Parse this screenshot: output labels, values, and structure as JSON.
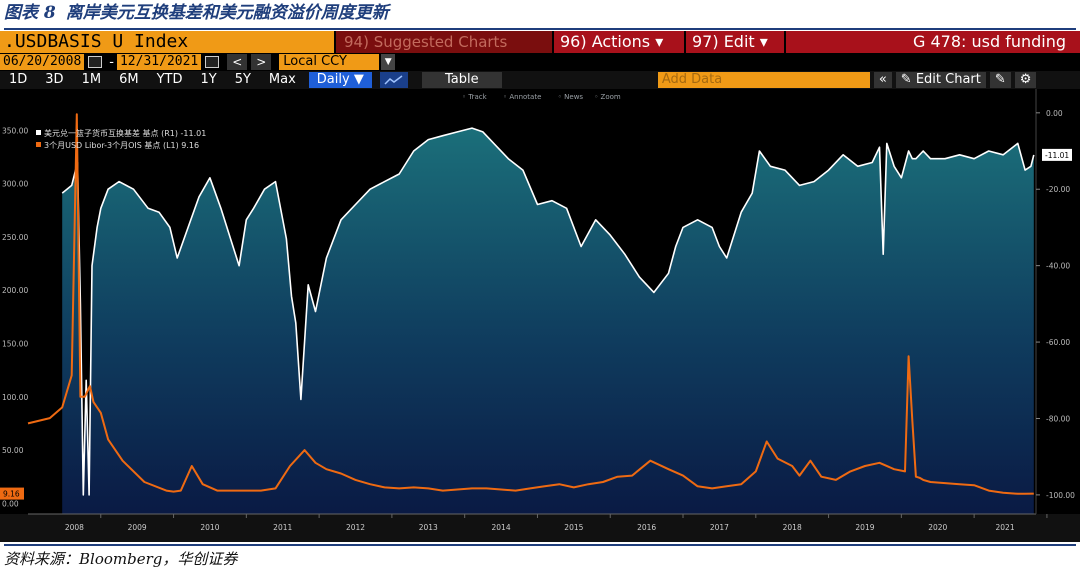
{
  "figure": {
    "label": "图表 8",
    "title": "离岸美元互换基差和美元融资溢价周度更新",
    "source": "资料来源：Bloomberg，华创证券"
  },
  "toolbar": {
    "ticker": ".USDBASIS U Index",
    "suggested": "94) Suggested Charts",
    "actions": "96) Actions ▾",
    "edit": "97) Edit ▾",
    "function": "G 478: usd funding"
  },
  "dates": {
    "start": "06/20/2008",
    "end": "12/31/2021",
    "currency": "Local CCY",
    "prev": "<",
    "next": ">"
  },
  "ranges": [
    "1D",
    "3D",
    "1M",
    "6M",
    "YTD",
    "1Y",
    "5Y",
    "Max"
  ],
  "controls": {
    "frequency": "Daily ▼",
    "table": "Table",
    "add_data_placeholder": "Add Data",
    "collapse": "«",
    "edit_chart": "✎ Edit Chart",
    "undo": "↶",
    "redo": "↷"
  },
  "chart_tools": [
    "Track",
    "Annotate",
    "News",
    "Zoom"
  ],
  "chart_data": {
    "type": "line",
    "x_labels": [
      "2008",
      "2009",
      "2010",
      "2011",
      "2012",
      "2013",
      "2014",
      "2015",
      "2016",
      "2017",
      "2018",
      "2019",
      "2020",
      "2021"
    ],
    "left_axis": {
      "ticks": [
        "350.00",
        "300.00",
        "250.00",
        "200.00",
        "150.00",
        "100.00",
        "50.00",
        "0.00"
      ],
      "range": [
        -10,
        370
      ]
    },
    "right_axis": {
      "ticks": [
        "0.00",
        "-20.00",
        "-40.00",
        "-60.00",
        "-80.00",
        "-100.00"
      ],
      "range": [
        -105,
        1
      ]
    },
    "series": [
      {
        "name": "美元兑一篮子货币互换基差 基点 (R1) -11.01",
        "axis": "right",
        "color": "#ffffff",
        "last_label": "-11.01",
        "x": [
          2008.47,
          2008.6,
          2008.68,
          2008.72,
          2008.76,
          2008.8,
          2008.84,
          2008.88,
          2008.95,
          2009.0,
          2009.1,
          2009.25,
          2009.45,
          2009.65,
          2009.8,
          2009.95,
          2010.05,
          2010.2,
          2010.35,
          2010.5,
          2010.65,
          2010.8,
          2010.9,
          2011.0,
          2011.1,
          2011.25,
          2011.4,
          2011.55,
          2011.62,
          2011.68,
          2011.75,
          2011.85,
          2011.95,
          2012.1,
          2012.3,
          2012.5,
          2012.7,
          2012.9,
          2013.1,
          2013.3,
          2013.5,
          2013.7,
          2013.9,
          2014.1,
          2014.25,
          2014.4,
          2014.6,
          2014.8,
          2015.0,
          2015.2,
          2015.4,
          2015.6,
          2015.8,
          2016.0,
          2016.2,
          2016.4,
          2016.6,
          2016.8,
          2016.9,
          2017.0,
          2017.2,
          2017.4,
          2017.5,
          2017.6,
          2017.8,
          2017.95,
          2018.05,
          2018.2,
          2018.4,
          2018.6,
          2018.8,
          2019.0,
          2019.2,
          2019.4,
          2019.6,
          2019.7,
          2019.75,
          2019.8,
          2019.9,
          2020.0,
          2020.1,
          2020.15,
          2020.2,
          2020.3,
          2020.4,
          2020.6,
          2020.8,
          2021.0,
          2021.2,
          2021.4,
          2021.6,
          2021.7,
          2021.78,
          2021.82
        ],
        "y": [
          -21,
          -19,
          -13,
          -50,
          -100,
          -70,
          -100,
          -40,
          -30,
          -25,
          -20,
          -18,
          -20,
          -25,
          -26,
          -30,
          -38,
          -30,
          -22,
          -17,
          -25,
          -34,
          -40,
          -28,
          -25,
          -20,
          -18,
          -33,
          -48,
          -55,
          -75,
          -45,
          -52,
          -38,
          -28,
          -24,
          -20,
          -18,
          -16,
          -10,
          -7,
          -6,
          -5,
          -4,
          -5,
          -8,
          -12,
          -15,
          -24,
          -23,
          -25,
          -35,
          -28,
          -32,
          -37,
          -43,
          -47,
          -42,
          -35,
          -30,
          -28,
          -30,
          -35,
          -38,
          -26,
          -21,
          -10,
          -14,
          -15,
          -19,
          -18,
          -15,
          -11,
          -14,
          -13,
          -9,
          -37,
          -8,
          -14,
          -17,
          -10,
          -12,
          -12,
          -10,
          -12,
          -12,
          -11,
          -12,
          -10,
          -11,
          -8,
          -15,
          -14,
          -11.01
        ]
      },
      {
        "name": "3个月USD Libor-3个月OIS 基点 (L1) 9.16",
        "axis": "left",
        "color": "#ef6a12",
        "last_label": "9.16",
        "x": [
          2008.0,
          2008.3,
          2008.47,
          2008.6,
          2008.67,
          2008.72,
          2008.78,
          2008.85,
          2008.9,
          2009.0,
          2009.1,
          2009.3,
          2009.6,
          2009.9,
          2010.0,
          2010.1,
          2010.25,
          2010.4,
          2010.6,
          2010.8,
          2011.0,
          2011.2,
          2011.4,
          2011.6,
          2011.8,
          2011.95,
          2012.1,
          2012.3,
          2012.5,
          2012.7,
          2012.9,
          2013.1,
          2013.3,
          2013.5,
          2013.7,
          2013.9,
          2014.1,
          2014.3,
          2014.5,
          2014.7,
          2014.9,
          2015.1,
          2015.3,
          2015.5,
          2015.7,
          2015.9,
          2016.1,
          2016.3,
          2016.55,
          2016.8,
          2017.0,
          2017.2,
          2017.4,
          2017.6,
          2017.8,
          2018.0,
          2018.15,
          2018.3,
          2018.5,
          2018.6,
          2018.75,
          2018.9,
          2019.1,
          2019.3,
          2019.5,
          2019.7,
          2019.9,
          2020.05,
          2020.1,
          2020.15,
          2020.2,
          2020.25,
          2020.3,
          2020.4,
          2020.6,
          2020.8,
          2021.0,
          2021.2,
          2021.4,
          2021.6,
          2021.7,
          2021.82
        ],
        "y": [
          75,
          80,
          90,
          120,
          365,
          100,
          100,
          110,
          95,
          85,
          60,
          40,
          20,
          12,
          11,
          12,
          35,
          18,
          12,
          12,
          12,
          12,
          14,
          35,
          50,
          38,
          32,
          28,
          22,
          18,
          15,
          14,
          15,
          14,
          12,
          13,
          14,
          14,
          13,
          12,
          14,
          16,
          18,
          15,
          18,
          20,
          25,
          26,
          40,
          32,
          26,
          16,
          14,
          16,
          18,
          30,
          58,
          42,
          35,
          26,
          40,
          25,
          22,
          30,
          35,
          38,
          32,
          30,
          138,
          78,
          25,
          24,
          22,
          20,
          19,
          18,
          17,
          12,
          10,
          9,
          9,
          9.16
        ]
      }
    ],
    "grid": false,
    "legend": "top-left"
  }
}
